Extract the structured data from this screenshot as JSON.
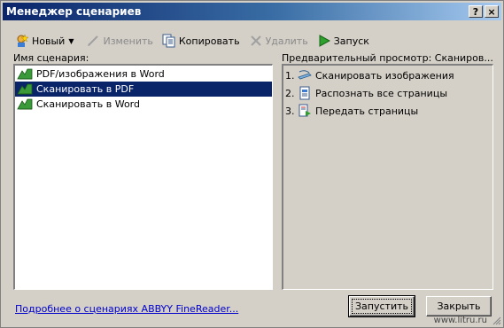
{
  "window": {
    "title": "Менеджер сценариев",
    "help_label": "?",
    "close_label": "×"
  },
  "toolbar": {
    "new_label": "Новый",
    "edit_label": "Изменить",
    "copy_label": "Копировать",
    "delete_label": "Удалить",
    "run_label": "Запуск"
  },
  "scenarios": {
    "header": "Имя сценария:",
    "items": [
      {
        "label": "PDF/изображения в Word",
        "selected": false
      },
      {
        "label": "Сканировать в PDF",
        "selected": true
      },
      {
        "label": "Сканировать в Word",
        "selected": false
      }
    ]
  },
  "preview": {
    "header": "Предварительный просмотр: Сканиров...",
    "steps": [
      {
        "num": "1.",
        "label": "Сканировать изображения"
      },
      {
        "num": "2.",
        "label": "Распознать все страницы"
      },
      {
        "num": "3.",
        "label": "Передать страницы"
      }
    ]
  },
  "footer": {
    "more_link": "Подробнее о сценариях ABBYY FineReader...",
    "run_button": "Запустить",
    "close_button": "Закрыть",
    "watermark": "www.litru.ru"
  }
}
